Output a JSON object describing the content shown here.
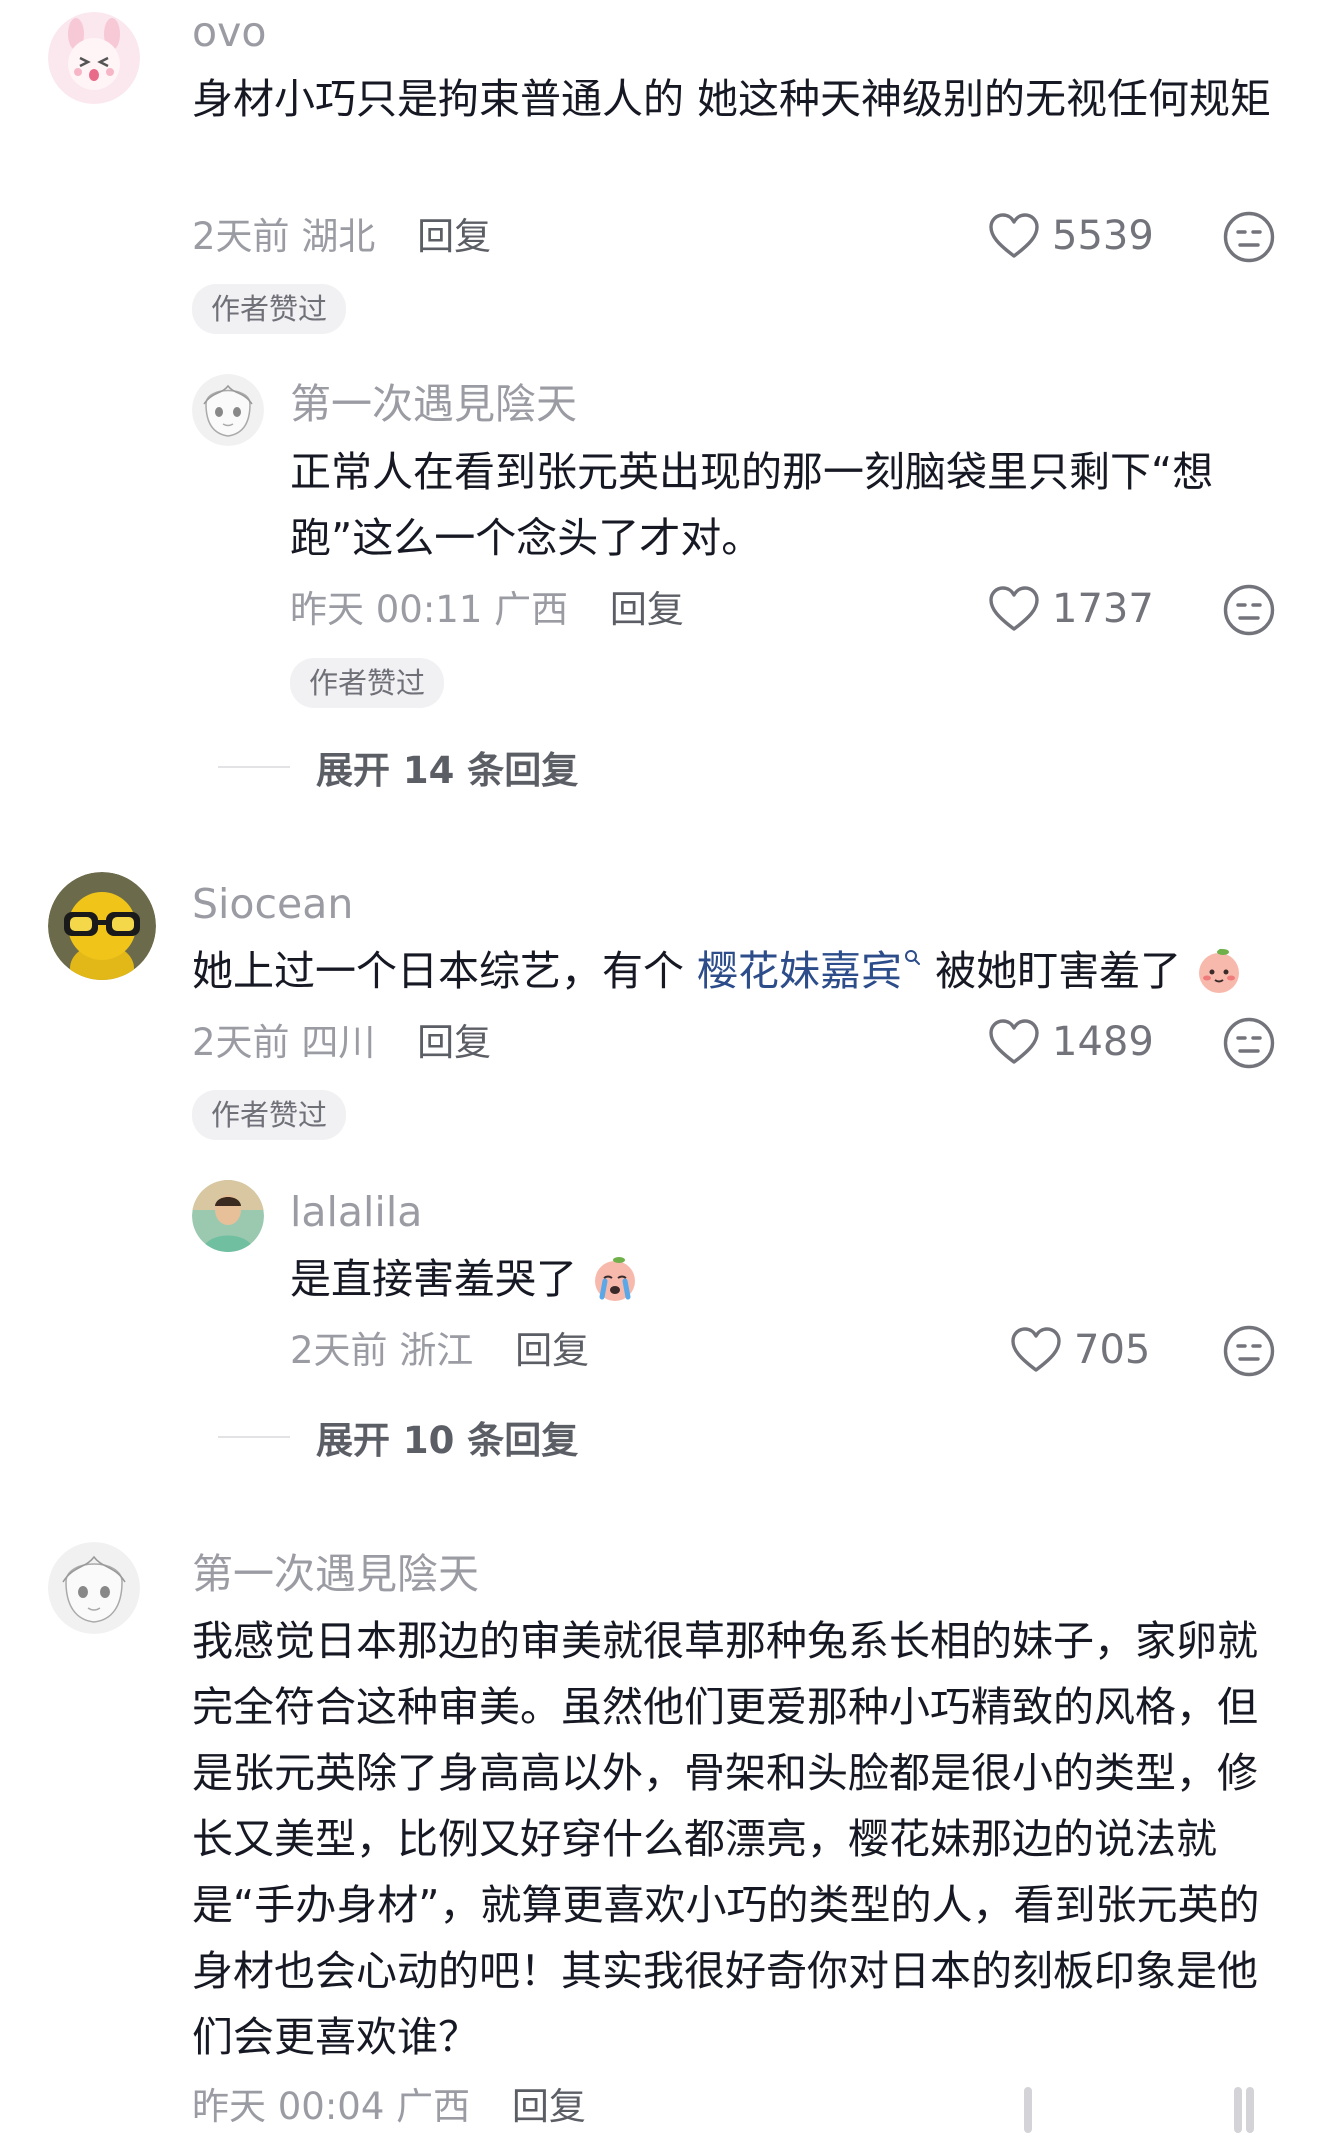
{
  "comments": [
    {
      "username": "ovo",
      "content": "身材小巧只是拘束普通人的 她这种天神级别的无视任何规矩",
      "time": "2天前",
      "location": "湖北",
      "reply_label": "回复",
      "likes": "5539",
      "badge": "作者赞过",
      "avatar_icon": "anime-bunny-avatar"
    },
    {
      "username": "第一次遇見陰天",
      "content": "正常人在看到张元英出现的那一刻脑袋里只剩下“想跑”这么一个念头了才对。",
      "time": "昨天 00:11",
      "location": "广西",
      "reply_label": "回复",
      "likes": "1737",
      "badge": "作者赞过",
      "expand_label": "展开 14 条回复",
      "avatar_icon": "anime-sketch-avatar"
    },
    {
      "username": "Siocean",
      "content_before": "她上过一个日本综艺，有个 ",
      "mention": "樱花妹嘉宾",
      "content_after": " 被她盯害羞了",
      "time": "2天前",
      "location": "四川",
      "reply_label": "回复",
      "likes": "1489",
      "badge": "作者赞过",
      "avatar_icon": "glasses-figure-avatar"
    },
    {
      "username": "lalalila",
      "content": "是直接害羞哭了",
      "time": "2天前",
      "location": "浙江",
      "reply_label": "回复",
      "likes": "705",
      "expand_label": "展开 10 条回复",
      "avatar_icon": "photo-avatar"
    },
    {
      "username": "第一次遇見陰天",
      "content": "我感觉日本那边的审美就很草那种兔系长相的妹子，家卵就完全符合这种审美。虽然他们更爱那种小巧精致的风格，但是张元英除了身高高以外，骨架和头脸都是很小的类型，修长又美型，比例又好穿什么都漂亮，樱花妹那边的说法就是“手办身材”，就算更喜欢小巧的类型的人，看到张元英的身材也会心动的吧！其实我很好奇你对日本的刻板印象是他们会更喜欢谁？",
      "time": "昨天 00:04",
      "location": "广西",
      "reply_label": "回复",
      "avatar_icon": "anime-sketch-avatar"
    }
  ]
}
